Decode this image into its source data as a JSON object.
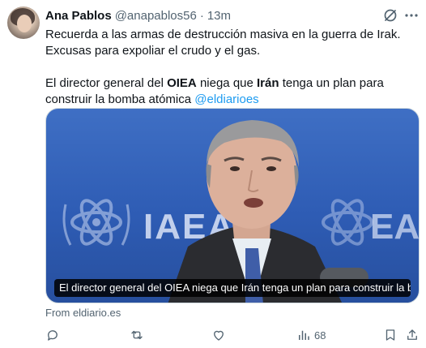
{
  "author": {
    "name": "Ana Pablos",
    "handle": "@anapablos56",
    "separator": "·",
    "time": "13m"
  },
  "tweet": {
    "line1": "Recuerda a las armas de destrucción masiva en la guerra de Irak. Excusas para expoliar el crudo y el gas.",
    "line2_part1": "El director general del ",
    "line2_bold1": "OIEA",
    "line2_part2": " niega que ",
    "line2_bold2": "Irán",
    "line2_part3": " tenga un plan para construir la bomba atómica ",
    "mention": "@eldiarioes"
  },
  "card": {
    "background_logo_text": "IAEA",
    "caption": "El director general del OIEA niega que Irán tenga un plan para construir la bom…",
    "caption_overflow": "as",
    "source": "From eldiario.es"
  },
  "actions": {
    "reply_icon": "reply-icon",
    "retweet_icon": "retweet-icon",
    "like_icon": "heart-icon",
    "views_icon": "views-icon",
    "views_count": "68",
    "bookmark_icon": "bookmark-icon",
    "share_icon": "share-icon"
  },
  "colors": {
    "accent": "#1d9bf0",
    "secondary_text": "#536471",
    "primary_text": "#0f1419",
    "media_blue": "#2e5cb4"
  }
}
